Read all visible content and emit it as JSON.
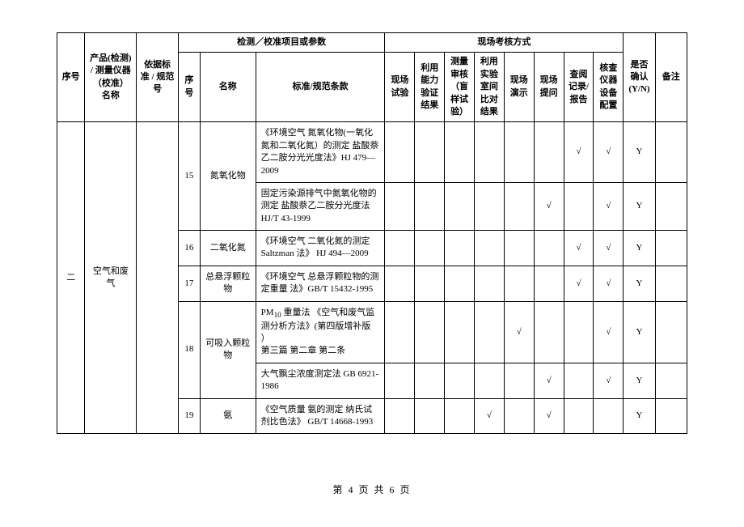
{
  "headers": {
    "seq": "序号",
    "product": "产品(检测) / 测量仪器（校准）名称",
    "basis": "依据标准 / 规范号",
    "testParams": "检测／校准项目或参数",
    "siteAssess": "现场考核方式",
    "confirm": "是否确认 (Y/N)",
    "remark": "备注",
    "subSeq": "序号",
    "name": "名称",
    "standard": "标准/规范条款",
    "m1": "现场试验",
    "m2": "利用能力验证结果",
    "m3": "测量审核（盲样试验）",
    "m4": "利用实验室间比对结果",
    "m5": "现场演示",
    "m6": "现场提问",
    "m7": "查阅记录/报告",
    "m8": "核查仪器设备配置"
  },
  "section": {
    "seq": "二",
    "product": "空气和废气",
    "basis": ""
  },
  "rows": [
    {
      "subSeq": "15",
      "name": "氮氧化物",
      "std": "《环境空气 氮氧化物(一氧化氮和二氧化氮）的测定 盐酸萘乙二胺分光光度法》HJ 479—2009",
      "m1": "",
      "m2": "",
      "m3": "",
      "m4": "",
      "m5": "",
      "m6": "",
      "m7": "√",
      "m8": "√",
      "confirm": "Y",
      "remark": "",
      "spanName": 2
    },
    {
      "std": "固定污染源排气中氮氧化物的测定 盐酸萘乙二胺分光度法  HJ/T 43-1999",
      "m1": "",
      "m2": "",
      "m3": "",
      "m4": "",
      "m5": "",
      "m6": "√",
      "m7": "",
      "m8": "√",
      "confirm": "Y",
      "remark": ""
    },
    {
      "subSeq": "16",
      "name": "二氧化氮",
      "std": "《环境空气  二氧化氮的测定   Saltzman 法》 HJ 494—2009",
      "m1": "",
      "m2": "",
      "m3": "",
      "m4": "",
      "m5": "",
      "m6": "",
      "m7": "√",
      "m8": "√",
      "confirm": "Y",
      "remark": "",
      "spanName": 1
    },
    {
      "subSeq": "17",
      "name": "总悬浮颗粒物",
      "std": "《环境空气  总悬浮颗粒物的测定重量  法》GB/T 15432-1995",
      "m1": "",
      "m2": "",
      "m3": "",
      "m4": "",
      "m5": "",
      "m6": "",
      "m7": "√",
      "m8": "√",
      "confirm": "Y",
      "remark": "",
      "spanName": 1
    },
    {
      "subSeq": "18",
      "name": "可吸入颗粒物",
      "std": "PM₁₀ 重量法  《空气和废气监测分析方法》(第四版增补版  ）\n第三篇  第二章  第二条",
      "m1": "",
      "m2": "",
      "m3": "",
      "m4": "",
      "m5": "√",
      "m6": "",
      "m7": "",
      "m8": "√",
      "confirm": "Y",
      "remark": "",
      "spanName": 2
    },
    {
      "std": "大气飘尘浓度测定法  GB 6921-1986",
      "m1": "",
      "m2": "",
      "m3": "",
      "m4": "",
      "m5": "",
      "m6": "√",
      "m7": "",
      "m8": "√",
      "confirm": "Y",
      "remark": ""
    },
    {
      "subSeq": "19",
      "name": "氨",
      "std": "《空气质量  氨的测定 纳氏试剂比色法》 GB/T 14668-1993",
      "m1": "",
      "m2": "",
      "m3": "",
      "m4": "√",
      "m5": "",
      "m6": "√",
      "m7": "",
      "m8": "",
      "confirm": "Y",
      "remark": "",
      "spanName": 1
    }
  ],
  "footer": "第 4 页 共 6 页"
}
